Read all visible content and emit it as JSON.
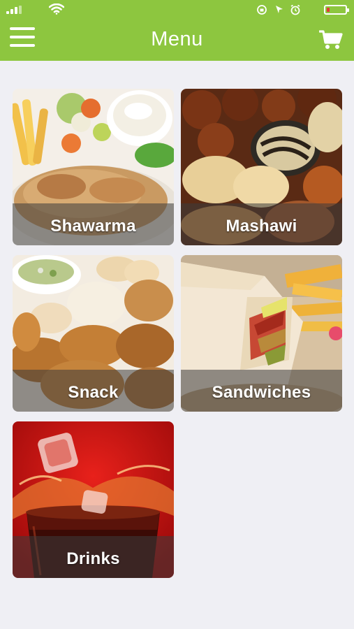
{
  "header": {
    "title": "Menu",
    "menu_icon": "hamburger-icon",
    "cart_icon": "cart-icon",
    "color": "#8dc63f"
  },
  "status_bar": {
    "icons": [
      "signal-icon",
      "wifi-icon",
      "rotation-lock-icon",
      "location-icon",
      "alarm-icon",
      "battery-icon"
    ],
    "battery_color": "#e53935"
  },
  "categories": [
    {
      "label": "Shawarma"
    },
    {
      "label": "Mashawi"
    },
    {
      "label": "Snack"
    },
    {
      "label": "Sandwiches"
    },
    {
      "label": "Drinks"
    }
  ]
}
